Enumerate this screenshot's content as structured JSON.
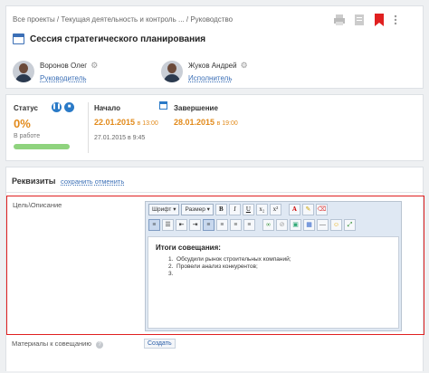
{
  "header": {
    "breadcrumb": "Все проекты / Текущая деятельность и контроль ... / Руководство",
    "title": "Сессия стратегического планирования",
    "people": [
      {
        "name": "Воронов Олег",
        "role": "Руководитель"
      },
      {
        "name": "Жуков Андрей",
        "role": "Исполнитель"
      }
    ],
    "icons": [
      "print-icon",
      "document-icon",
      "bookmark-icon"
    ],
    "bookmark_color": "#e02020"
  },
  "status": {
    "label": "Статус",
    "percent": "0%",
    "state": "В работе",
    "start_label": "Начало",
    "start_date": "22.01.2015",
    "start_time": "в 13:00",
    "start_sub": "27.01.2015 в 9:45",
    "end_label": "Завершение",
    "end_date": "28.01.2015",
    "end_time": "в 19:00",
    "accent": "#e28a1a"
  },
  "requisites": {
    "heading": "Реквизиты",
    "save": "сохранить",
    "cancel": "отменить",
    "field_label": "Цель\\Описание",
    "toolbar": {
      "font": "Шрифт",
      "size": "Размер",
      "bold": "B",
      "italic": "I",
      "underline": "U",
      "subscript": "x₂",
      "superscript": "x²"
    },
    "editor": {
      "heading": "Итоги совещания:",
      "items": [
        "Обсудили рынок строительных компаний;",
        "Провели анализ конкурентов;",
        ""
      ]
    },
    "materials_label": "Материалы к совещанию",
    "create_label": "Создать"
  }
}
